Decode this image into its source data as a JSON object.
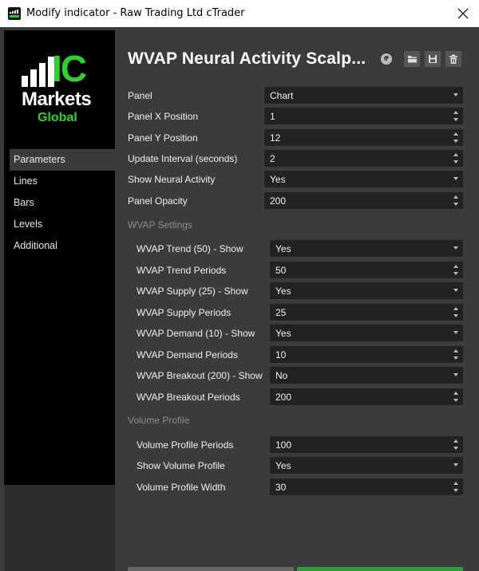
{
  "window": {
    "title": "Modify indicator - Raw Trading Ltd cTrader"
  },
  "brand": {
    "ic": "IC",
    "markets": "Markets",
    "global": "Global",
    "green": "#2ed12e"
  },
  "sidebar": {
    "items": [
      {
        "label": "Parameters",
        "active": true
      },
      {
        "label": "Lines"
      },
      {
        "label": "Bars"
      },
      {
        "label": "Levels"
      },
      {
        "label": "Additional"
      }
    ]
  },
  "header": {
    "title": "WVAP Neural Activity Scalp..."
  },
  "params": {
    "panel": {
      "label": "Panel",
      "value": "Chart"
    },
    "panel_x": {
      "label": "Panel X Position",
      "value": "1"
    },
    "panel_y": {
      "label": "Panel Y Position",
      "value": "12"
    },
    "update_interval": {
      "label": "Update Interval (seconds)",
      "value": "2"
    },
    "show_neural": {
      "label": "Show Neural Activity",
      "value": "Yes"
    },
    "panel_opacity": {
      "label": "Panel Opacity",
      "value": "200"
    }
  },
  "wvap": {
    "section": "WVAP Settings",
    "trend_show": {
      "label": "WVAP Trend (50) - Show",
      "value": "Yes"
    },
    "trend_periods": {
      "label": "WVAP Trend Periods",
      "value": "50"
    },
    "supply_show": {
      "label": "WVAP Supply (25) - Show",
      "value": "Yes"
    },
    "supply_periods": {
      "label": "WVAP Supply Periods",
      "value": "25"
    },
    "demand_show": {
      "label": "WVAP Demand (10) - Show",
      "value": "Yes"
    },
    "demand_periods": {
      "label": "WVAP Demand Periods",
      "value": "10"
    },
    "breakout_show": {
      "label": "WVAP Breakout (200) - Show",
      "value": "No"
    },
    "breakout_periods": {
      "label": "WVAP Breakout Periods",
      "value": "200"
    }
  },
  "volume": {
    "section": "Volume Profile",
    "periods": {
      "label": "Volume Profile Periods",
      "value": "100"
    },
    "show": {
      "label": "Show Volume Profile",
      "value": "Yes"
    },
    "width": {
      "label": "Volume Profile Width",
      "value": "30"
    }
  }
}
